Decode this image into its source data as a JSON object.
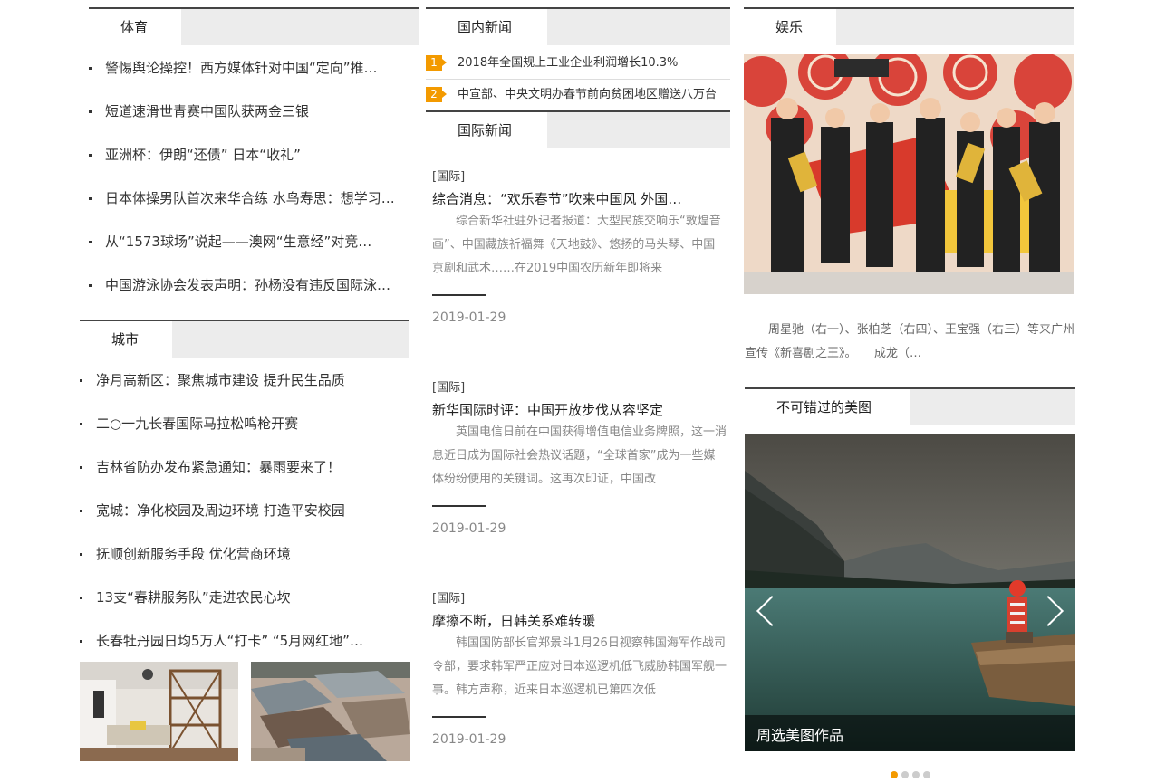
{
  "sports": {
    "heading": "体育",
    "items": [
      "警惕舆论操控！西方媒体针对中国“定向”推…",
      "短道速滑世青赛中国队获两金三银",
      "亚洲杯：伊朗“还债” 日本“收礼”",
      "日本体操男队首次来华合练 水鸟寿思：想学习…",
      "从“1573球场”说起——澳网“生意经”对竞…",
      "中国游泳协会发表声明：孙杨没有违反国际泳…"
    ]
  },
  "city": {
    "heading": "城市",
    "items": [
      "净月高新区：聚焦城市建设 提升民生品质",
      "二○一九长春国际马拉松鸣枪开赛",
      "吉林省防办发布紧急通知：暴雨要来了！",
      "宽城：净化校园及周边环境 打造平安校园",
      "抚顺创新服务手段 优化营商环境",
      "13支“春耕服务队”走进农民心坎",
      "长春牡丹园日均5万人“打卡” “5月网红地”…"
    ]
  },
  "domestic": {
    "heading": "国内新闻",
    "items": [
      {
        "rank": "1",
        "text": "2018年全国规上工业企业利润增长10.3%"
      },
      {
        "rank": "2",
        "text": "中宣部、中央文明办春节前向贫困地区赠送八万台"
      }
    ]
  },
  "international": {
    "heading": "国际新闻",
    "articles": [
      {
        "tag": "[国际]",
        "title": "综合消息：“欢乐春节”吹来中国风 外国…",
        "summary": "综合新华社驻外记者报道：大型民族交响乐“敦煌音画”、中国藏族祈福舞《天地鼓》、悠扬的马头琴、中国京剧和武术……在2019中国农历新年即将来",
        "date": "2019-01-29"
      },
      {
        "tag": "[国际]",
        "title": "新华国际时评：中国开放步伐从容坚定",
        "summary": "英国电信日前在中国获得增值电信业务牌照，这一消息近日成为国际社会热议话题，“全球首家”成为一些媒体纷纷使用的关键词。这再次印证，中国改",
        "date": "2019-01-29"
      },
      {
        "tag": "[国际]",
        "title": "摩擦不断，日韩关系难转暖",
        "summary": "韩国国防部长官郑景斗1月26日视察韩国海军作战司令部，要求韩军严正应对日本巡逻机低飞威胁韩国军舰一事。韩方声称，近来日本巡逻机已第四次低",
        "date": "2019-01-29"
      }
    ]
  },
  "entertainment": {
    "heading": "娱乐",
    "caption": "周星驰（右一）、张柏芝（右四）、王宝强（右三）等来广州宣传《新喜剧之王》。　　成龙（…"
  },
  "gallery": {
    "heading": "不可错过的美图",
    "caption": "周选美图作品",
    "slide_count": 4,
    "active_slide": 1
  },
  "colors": {
    "accent": "#f39a00",
    "tab_bar": "#ececec",
    "rule": "#444444"
  }
}
